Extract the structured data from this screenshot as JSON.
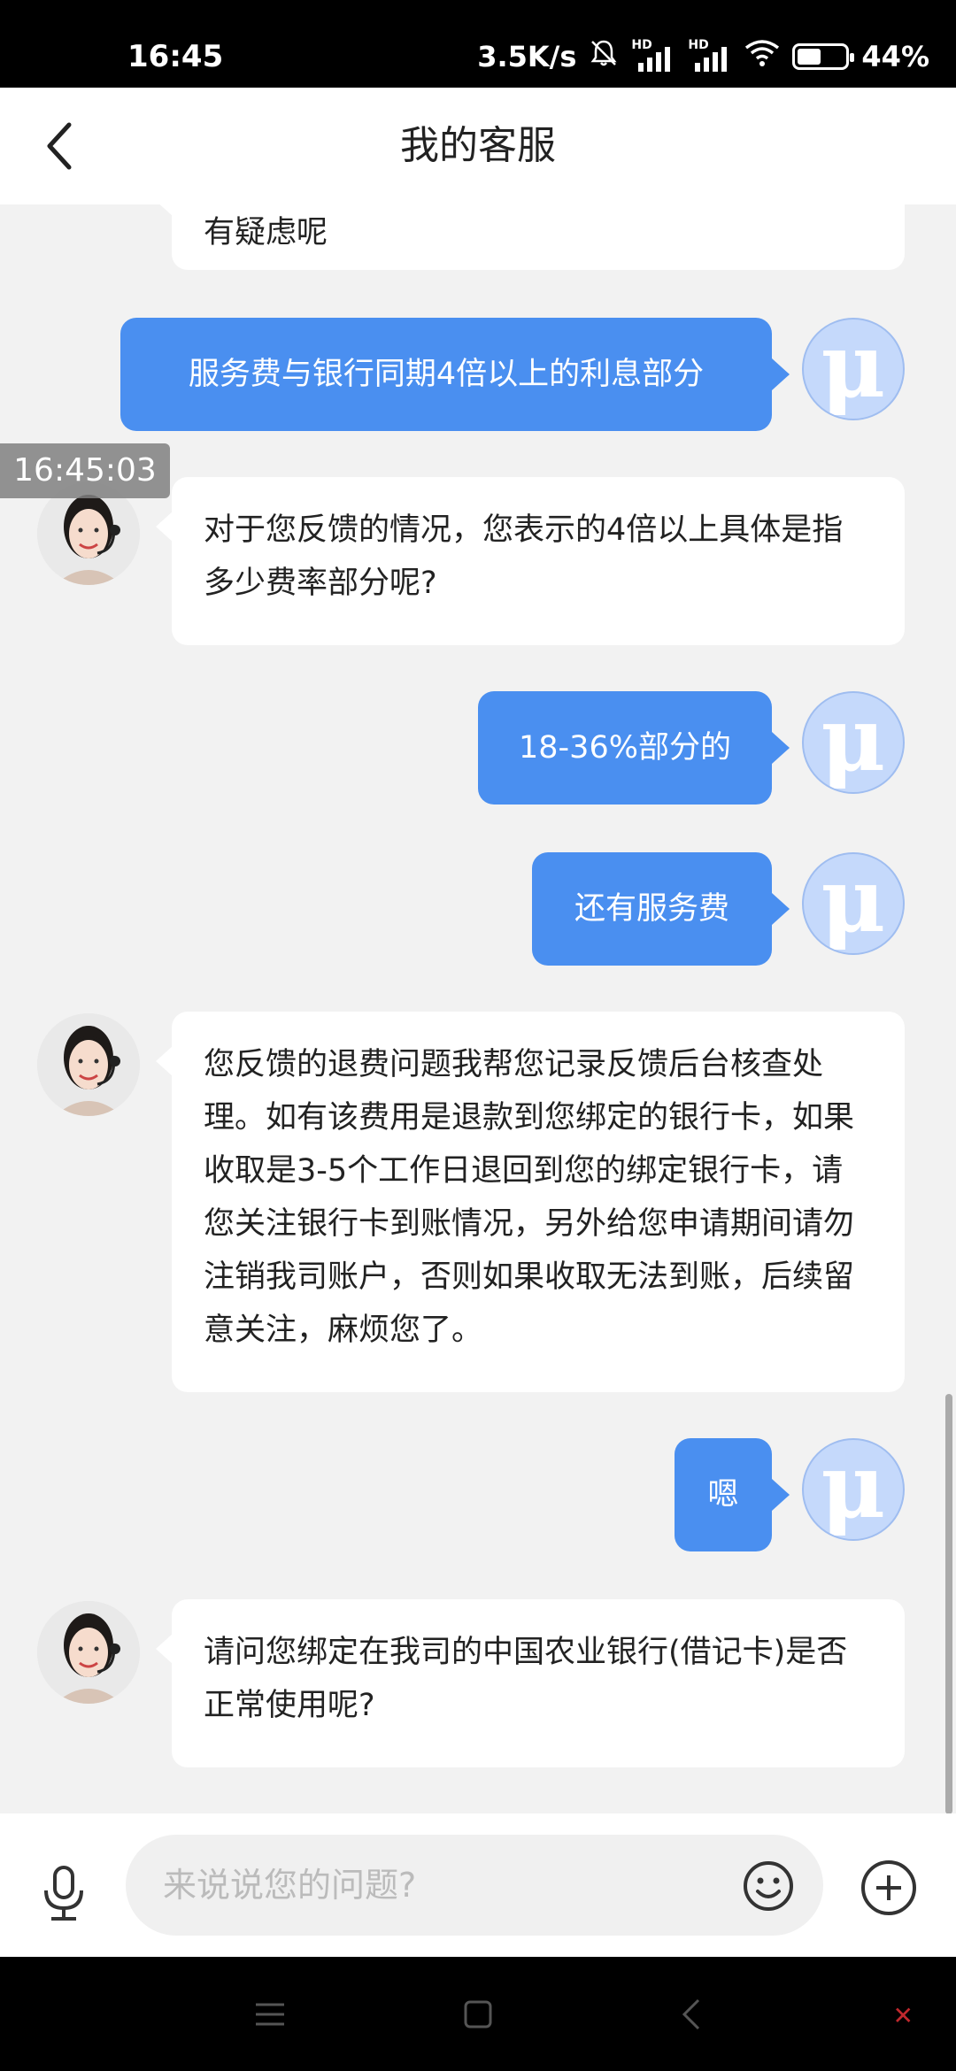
{
  "status_bar": {
    "time": "16:45",
    "net_speed": "3.5K/s",
    "sim1_label": "HD",
    "sim2_label": "HD",
    "battery": "44%",
    "battery_level": 0.44
  },
  "header": {
    "title": "我的客服"
  },
  "timestamp_overlay": "16:45:03",
  "messages": [
    {
      "from": "agent",
      "text": "有疑虑呢"
    },
    {
      "from": "user",
      "text": "服务费与银行同期4倍以上的利息部分"
    },
    {
      "from": "agent",
      "text": "对于您反馈的情况，您表示的4倍以上具体是指多少费率部分呢?"
    },
    {
      "from": "user",
      "text": "18-36%部分的"
    },
    {
      "from": "user",
      "text": "还有服务费"
    },
    {
      "from": "agent",
      "text": "您反馈的退费问题我帮您记录反馈后台核查处理。如有该费用是退款到您绑定的银行卡，如果收取是3-5个工作日退回到您的绑定银行卡，请您关注银行卡到账情况，另外给您申请期间请勿注销我司账户，否则如果收取无法到账，后续留意关注，麻烦您了。"
    },
    {
      "from": "user",
      "text": "嗯"
    },
    {
      "from": "agent",
      "text": "请问您绑定在我司的中国农业银行(借记卡)是否正常使用呢?"
    }
  ],
  "user_avatar_glyph": "μ",
  "input": {
    "placeholder": "来说说您的问题?",
    "value": ""
  },
  "icons": {
    "back": "chevron-left-icon",
    "mic": "microphone-icon",
    "emoji": "smiley-icon",
    "plus": "plus-circle-icon",
    "nav_menu": "menu-icon",
    "nav_home": "square-home-icon",
    "nav_back": "triangle-back-icon"
  },
  "colors": {
    "user_bubble": "#4a8ff0",
    "agent_bubble": "#ffffff",
    "chat_background": "#f2f2f2",
    "user_avatar": "#c5d9fb"
  }
}
